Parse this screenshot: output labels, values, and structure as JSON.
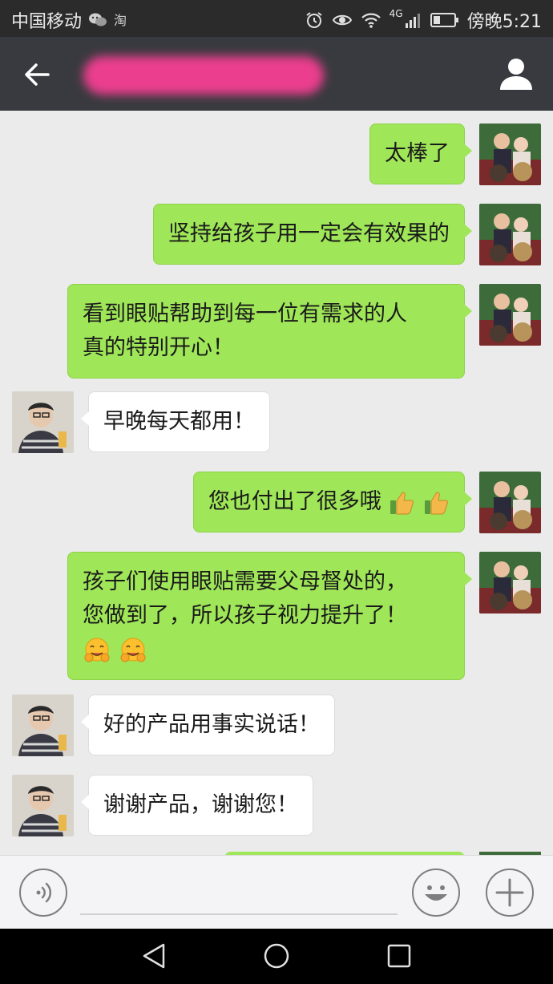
{
  "status_bar": {
    "carrier": "中国移动",
    "network": "4G",
    "time": "傍晚5:21",
    "icons": [
      "wechat-icon",
      "taobao-icon",
      "alarm-icon",
      "eye-icon",
      "wifi-icon",
      "signal-icon",
      "battery-icon"
    ]
  },
  "header": {
    "back_icon": "arrow-left-icon",
    "profile_icon": "person-icon",
    "title_obscured": true,
    "title_blur_color": "#ec3e8e"
  },
  "messages": [
    {
      "sender": "me",
      "lines": [
        "太棒了"
      ],
      "emoji": []
    },
    {
      "sender": "me",
      "lines": [
        "坚持给孩子用一定会有效果的"
      ],
      "emoji": []
    },
    {
      "sender": "me",
      "lines": [
        "看到眼贴帮助到每一位有需求的人",
        "真的特别开心！"
      ],
      "emoji": []
    },
    {
      "sender": "other",
      "lines": [
        "早晚每天都用！"
      ],
      "emoji": []
    },
    {
      "sender": "me",
      "lines": [
        "您也付出了很多哦"
      ],
      "emoji": [
        "thumbs-up-icon",
        "thumbs-up-icon"
      ]
    },
    {
      "sender": "me",
      "lines": [
        "孩子们使用眼贴需要父母督处的，",
        "您做到了，所以孩子视力提升了！"
      ],
      "emoji": [
        "hug-emoji-icon",
        "hug-emoji-icon"
      ]
    },
    {
      "sender": "other",
      "lines": [
        "好的产品用事实说话！"
      ],
      "emoji": []
    },
    {
      "sender": "other",
      "lines": [
        "谢谢产品，谢谢您！"
      ],
      "emoji": []
    }
  ],
  "input_bar": {
    "voice_icon": "voice-icon",
    "input_value": "",
    "emoji_icon": "smiley-icon",
    "plus_icon": "plus-icon"
  },
  "nav_bar": {
    "icons": [
      "back-triangle-icon",
      "home-circle-icon",
      "recents-square-icon"
    ]
  },
  "colors": {
    "my_bubble": "#9fe658",
    "other_bubble": "#ffffff",
    "chat_bg": "#ebebeb",
    "header_bg": "#393a3f",
    "status_bg": "#2b2b2b"
  }
}
